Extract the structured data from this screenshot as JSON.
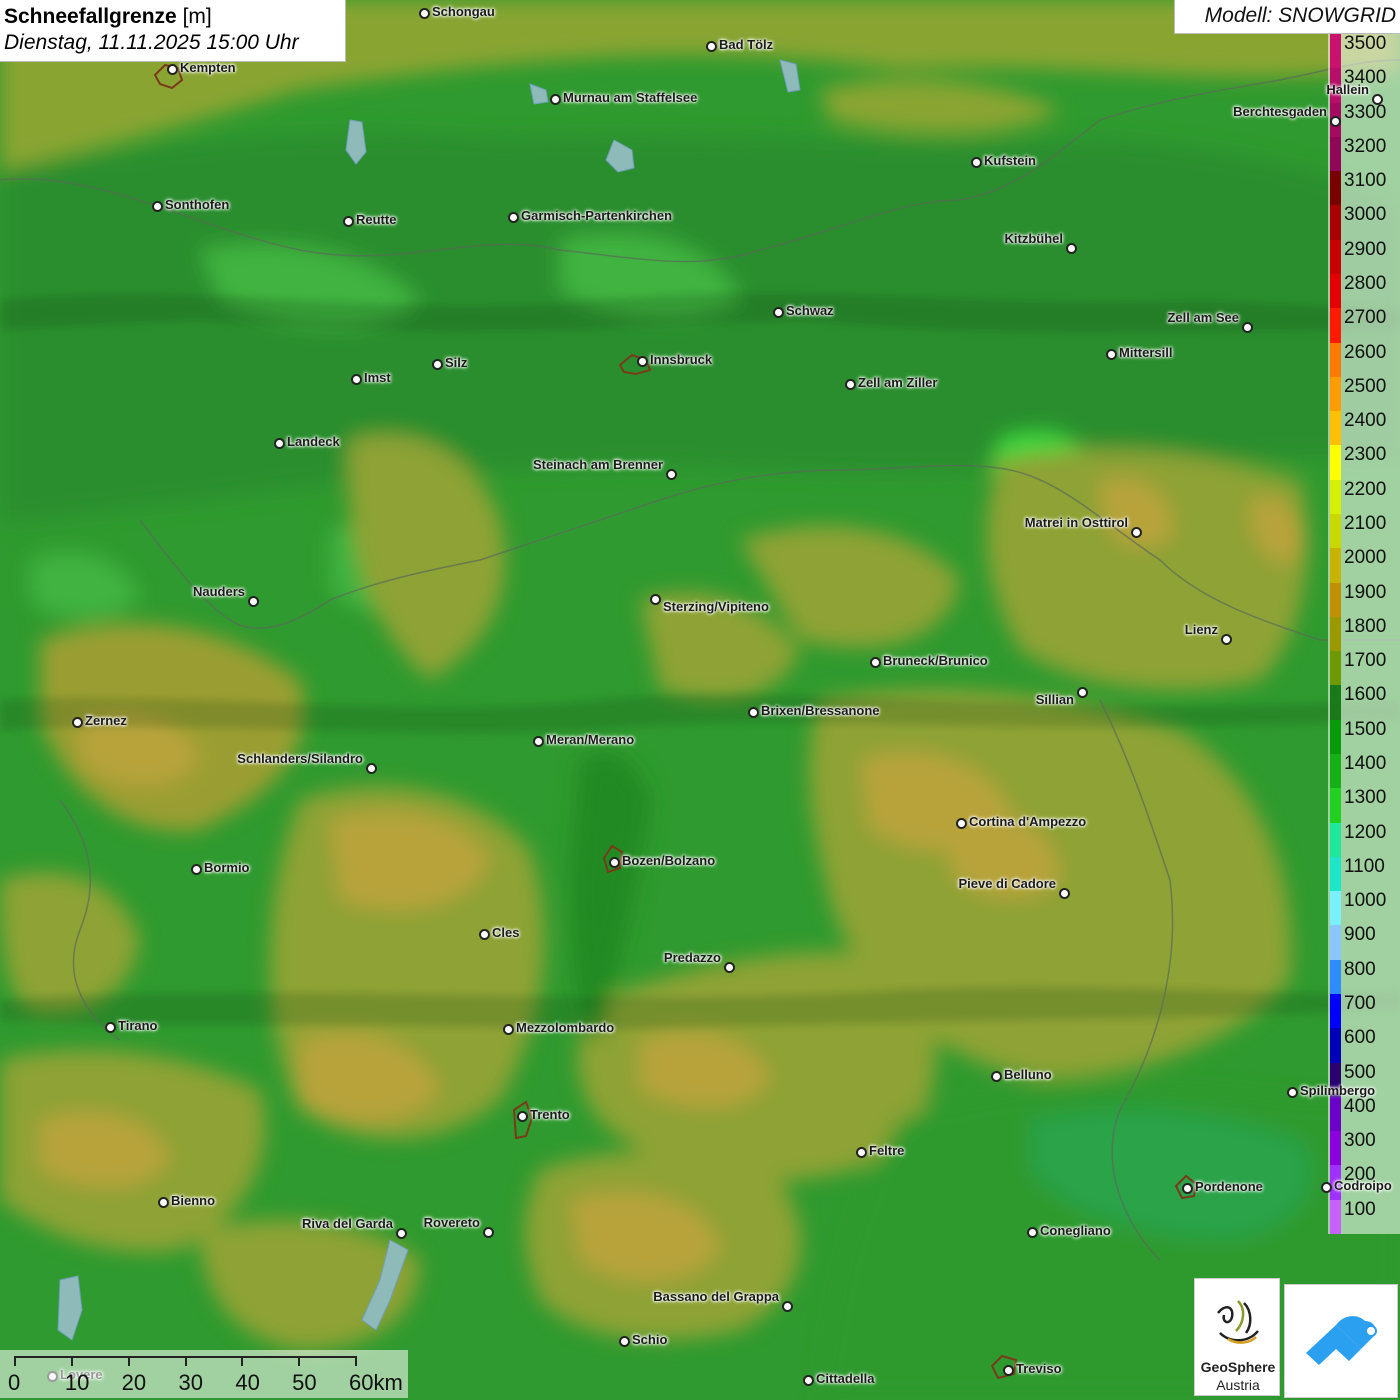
{
  "title": {
    "name": "Schneefallgrenze",
    "unit": "[m]",
    "datetime": "Dienstag, 11.11.2025 15:00 Uhr"
  },
  "model_label": "Modell: SNOWGRID",
  "legend": [
    {
      "value": "3500",
      "color": "#c8126e"
    },
    {
      "value": "3400",
      "color": "#b80d69"
    },
    {
      "value": "3300",
      "color": "#a60a60"
    },
    {
      "value": "3200",
      "color": "#920658"
    },
    {
      "value": "3100",
      "color": "#7a0000"
    },
    {
      "value": "3000",
      "color": "#a80000"
    },
    {
      "value": "2900",
      "color": "#c80000"
    },
    {
      "value": "2800",
      "color": "#e40000"
    },
    {
      "value": "2700",
      "color": "#ff1a00"
    },
    {
      "value": "2600",
      "color": "#ff7a00"
    },
    {
      "value": "2500",
      "color": "#ff9d00"
    },
    {
      "value": "2400",
      "color": "#ffc000"
    },
    {
      "value": "2300",
      "color": "#ffff00"
    },
    {
      "value": "2200",
      "color": "#d4f000"
    },
    {
      "value": "2100",
      "color": "#c8d800"
    },
    {
      "value": "2000",
      "color": "#c8b400"
    },
    {
      "value": "1900",
      "color": "#c09000"
    },
    {
      "value": "1800",
      "color": "#9a9a00"
    },
    {
      "value": "1700",
      "color": "#6e9a00"
    },
    {
      "value": "1600",
      "color": "#1a7a1a"
    },
    {
      "value": "1500",
      "color": "#089b08"
    },
    {
      "value": "1400",
      "color": "#16b016"
    },
    {
      "value": "1300",
      "color": "#22d022"
    },
    {
      "value": "1200",
      "color": "#20e89a"
    },
    {
      "value": "1100",
      "color": "#1de6c8"
    },
    {
      "value": "1000",
      "color": "#7af0ff"
    },
    {
      "value": "900",
      "color": "#8ac6ff"
    },
    {
      "value": "800",
      "color": "#2f8cff"
    },
    {
      "value": "700",
      "color": "#0000ff"
    },
    {
      "value": "600",
      "color": "#0000b8"
    },
    {
      "value": "500",
      "color": "#2a0070"
    },
    {
      "value": "400",
      "color": "#6a00c8"
    },
    {
      "value": "300",
      "color": "#8c00e0"
    },
    {
      "value": "200",
      "color": "#a030ff"
    },
    {
      "value": "100",
      "color": "#c860ff"
    }
  ],
  "cities": [
    {
      "name": "Schongau"
    },
    {
      "name": "Bad Tölz"
    },
    {
      "name": "Kempten"
    },
    {
      "name": "Murnau am Staffelsee"
    },
    {
      "name": "Hallein"
    },
    {
      "name": "Berchtesgaden"
    },
    {
      "name": "Kufstein"
    },
    {
      "name": "Sonthofen"
    },
    {
      "name": "Reutte"
    },
    {
      "name": "Garmisch-Partenkirchen"
    },
    {
      "name": "Kitzbühel"
    },
    {
      "name": "Schwaz"
    },
    {
      "name": "Zell am See"
    },
    {
      "name": "Innsbruck"
    },
    {
      "name": "Mittersill"
    },
    {
      "name": "Imst"
    },
    {
      "name": "Silz"
    },
    {
      "name": "Zell am Ziller"
    },
    {
      "name": "Landeck"
    },
    {
      "name": "Steinach am Brenner"
    },
    {
      "name": "Matrei in Osttirol"
    },
    {
      "name": "Nauders"
    },
    {
      "name": "Sterzing/Vipiteno"
    },
    {
      "name": "Lienz"
    },
    {
      "name": "Bruneck/Brunico"
    },
    {
      "name": "Sillian"
    },
    {
      "name": "Zernez"
    },
    {
      "name": "Brixen/Bressanone"
    },
    {
      "name": "Meran/Merano"
    },
    {
      "name": "Schlanders/Silandro"
    },
    {
      "name": "Cortina d'Ampezzo"
    },
    {
      "name": "Bormio"
    },
    {
      "name": "Bozen/Bolzano"
    },
    {
      "name": "Pieve di Cadore"
    },
    {
      "name": "Cles"
    },
    {
      "name": "Predazzo"
    },
    {
      "name": "Tirano"
    },
    {
      "name": "Mezzolombardo"
    },
    {
      "name": "Belluno"
    },
    {
      "name": "Spilimbergo"
    },
    {
      "name": "Trento"
    },
    {
      "name": "Feltre"
    },
    {
      "name": "Pordenone"
    },
    {
      "name": "Codroipo"
    },
    {
      "name": "Bienno"
    },
    {
      "name": "Riva del Garda"
    },
    {
      "name": "Rovereto"
    },
    {
      "name": "Conegliano"
    },
    {
      "name": "Bassano del Grappa"
    },
    {
      "name": "Schio"
    },
    {
      "name": "Cittadella"
    },
    {
      "name": "Treviso"
    },
    {
      "name": "Lovere"
    }
  ],
  "scale": {
    "labels": [
      "0",
      "10",
      "20",
      "30",
      "40",
      "50",
      "60km"
    ]
  },
  "logos": {
    "geosphere_name": "GeoSphere",
    "geosphere_country": "Austria"
  }
}
